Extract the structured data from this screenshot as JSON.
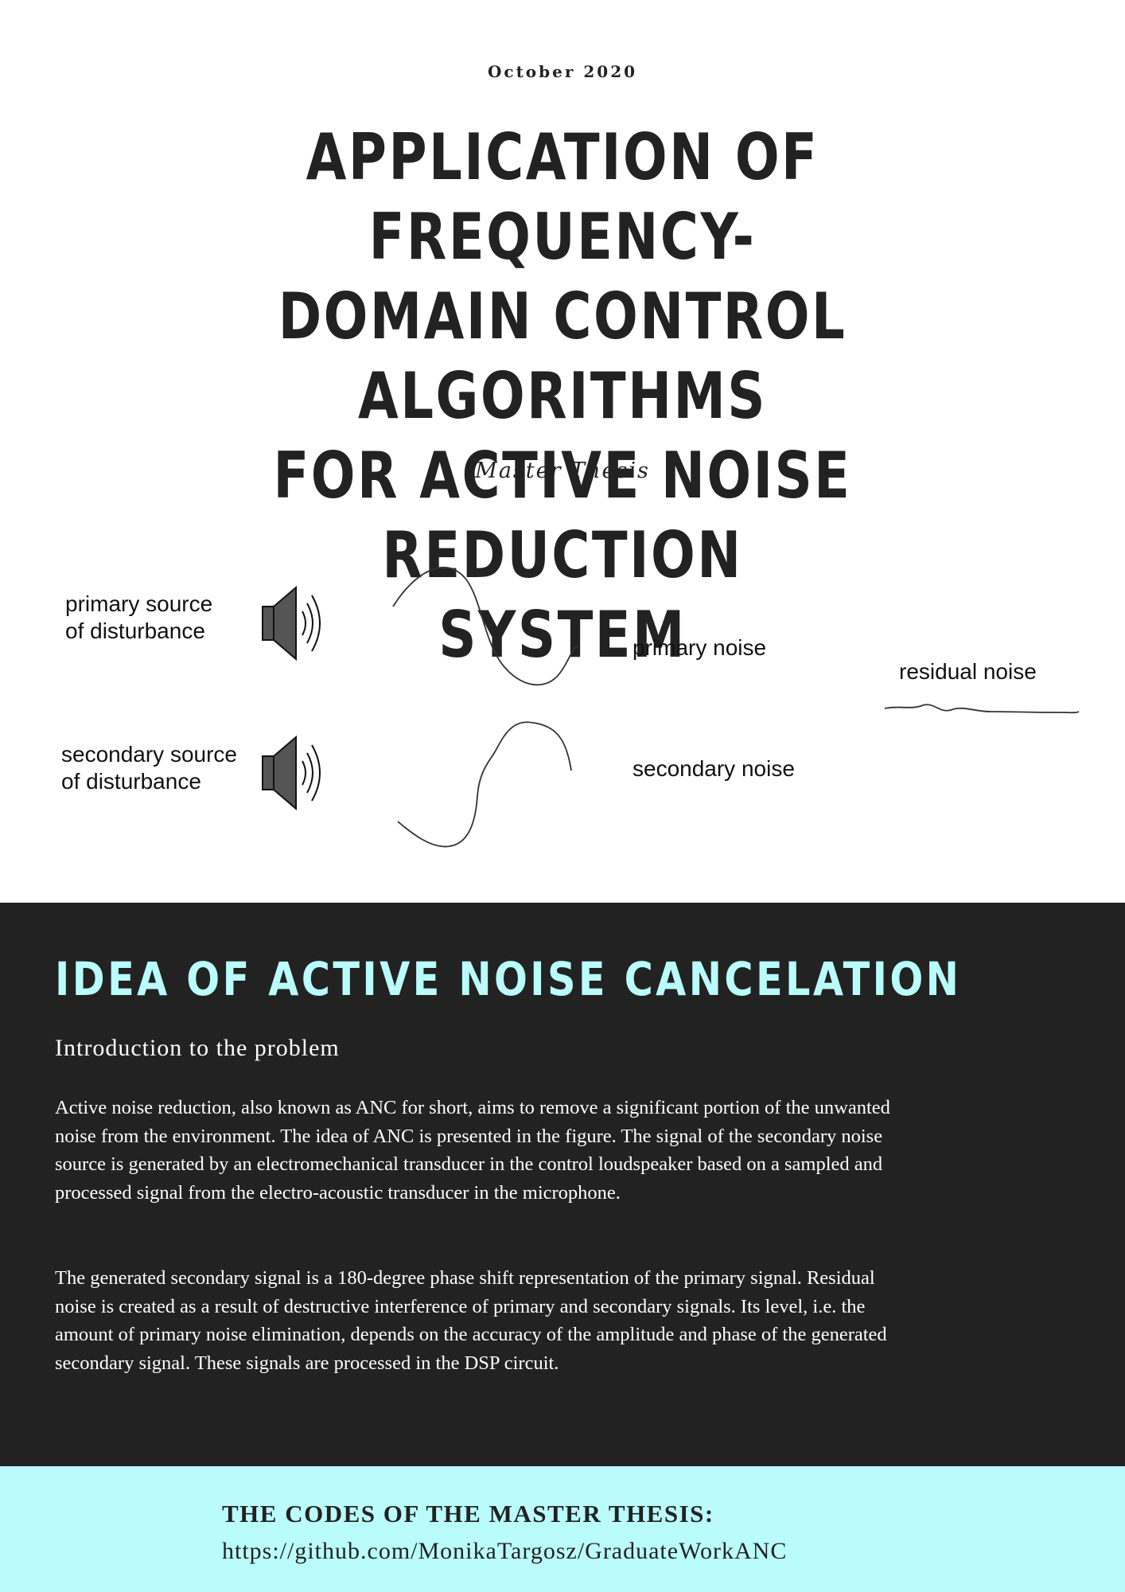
{
  "header": {
    "date": "October 2020",
    "title_lines": [
      "APPLICATION OF FREQUENCY-",
      "DOMAIN CONTROL ALGORITHMS",
      "FOR ACTIVE NOISE REDUCTION",
      "SYSTEM"
    ],
    "subtitle": "Master Thesis"
  },
  "diagram": {
    "primary_source_lines": [
      "primary source",
      "of disturbance"
    ],
    "secondary_source_lines": [
      "secondary source",
      "of disturbance"
    ],
    "primary_noise": "primary noise",
    "secondary_noise": "secondary noise",
    "residual_noise": "residual noise",
    "speaker_icon": "speaker-icon"
  },
  "section": {
    "title": "IDEA OF ACTIVE NOISE CANCELATION",
    "intro_heading": "Introduction to the problem",
    "paragraph_1": "Active noise reduction, also known as ANC for short, aims to remove a significant portion of the unwanted noise from the environment. The idea of ANC is presented in the figure. The signal of the secondary noise source is generated by an electromechanical transducer in the control loudspeaker based on a sampled and processed signal from the electro-acoustic transducer in the microphone.",
    "paragraph_2": "The generated secondary signal is a 180-degree phase shift representation of the primary signal. Residual noise is created as a result of destructive interference of primary and secondary signals. Its level, i.e. the amount of primary noise elimination, depends on the accuracy of the amplitude and phase of the generated secondary signal. These signals are processed in the DSP circuit."
  },
  "footer": {
    "label": "THE CODES OF THE MASTER THESIS:",
    "link": "https://github.com/MonikaTargosz/GraduateWorkANC"
  },
  "colors": {
    "dark_bg": "#222222",
    "accent_cyan": "#b9fcfb",
    "footer_bg": "#bafcfb"
  }
}
